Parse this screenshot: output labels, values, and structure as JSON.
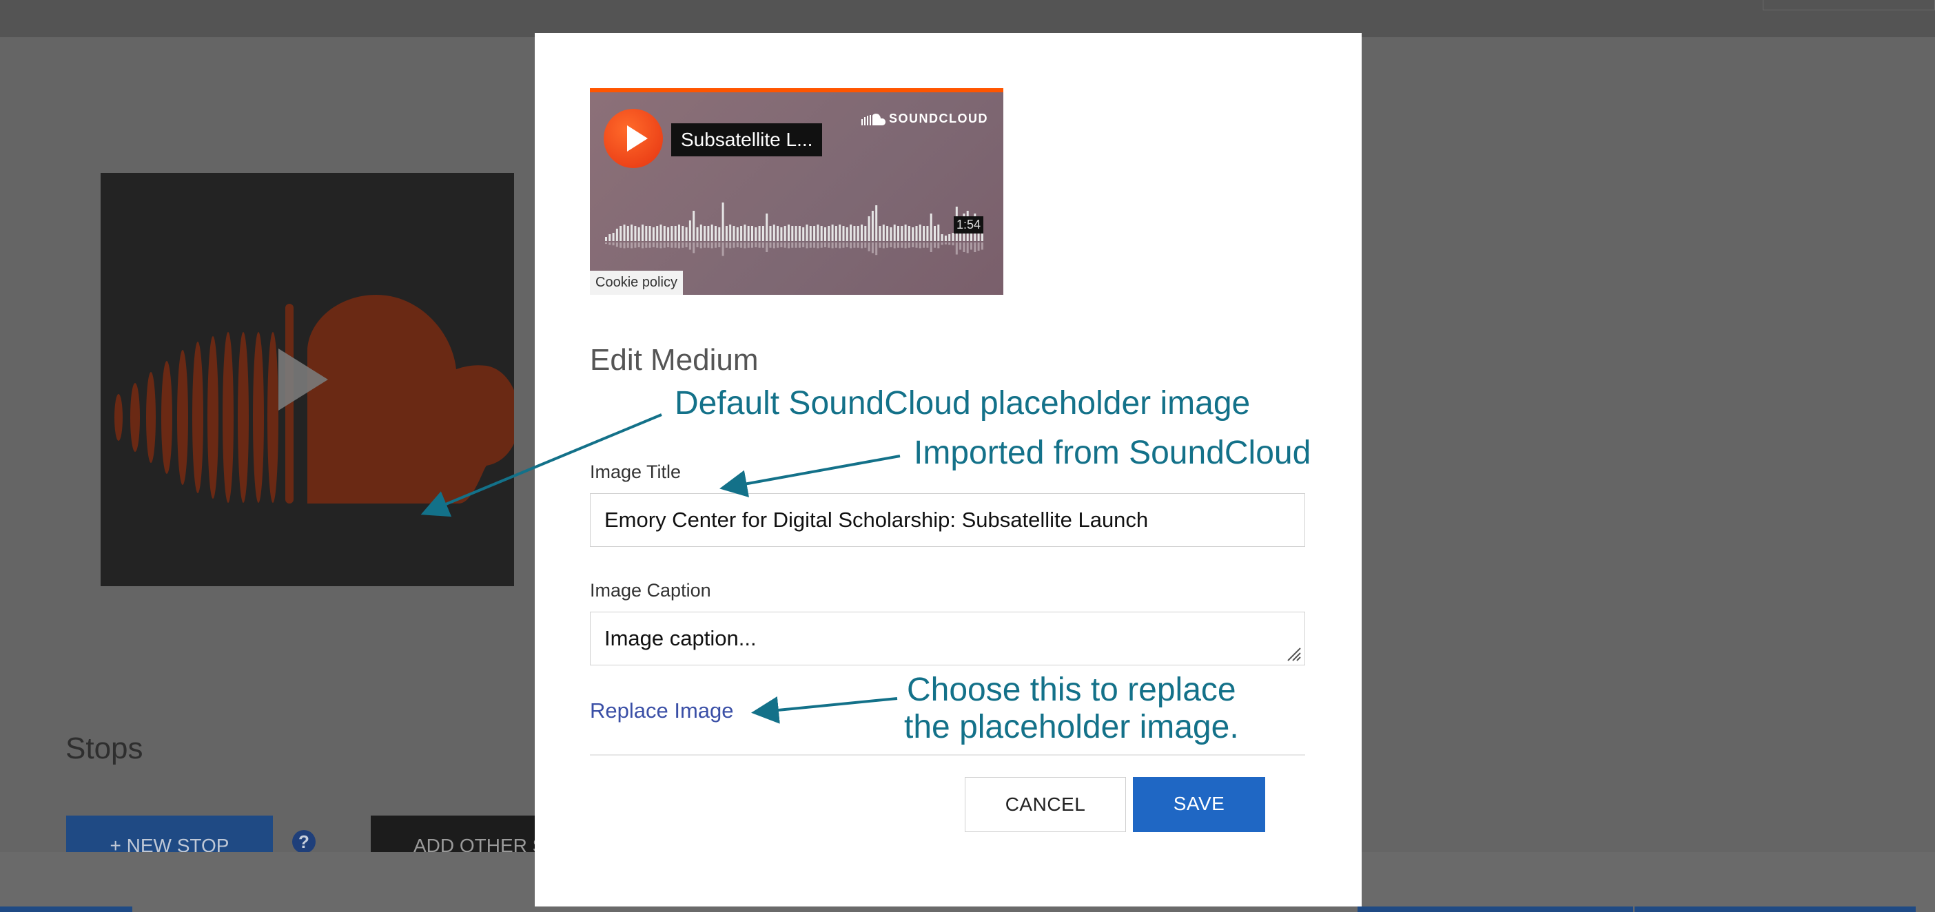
{
  "modal": {
    "embed": {
      "track_title": "Subsatellite L...",
      "brand": "SOUNDCLOUD",
      "duration": "1:54",
      "cookie_link": "Cookie policy"
    },
    "heading": "Edit Medium",
    "image_title_label": "Image Title",
    "image_title_value": "Emory Center for Digital Scholarship: Subsatellite Launch",
    "image_caption_label": "Image Caption",
    "image_caption_placeholder": "Image caption...",
    "replace_link": "Replace Image",
    "cancel_label": "CANCEL",
    "save_label": "SAVE"
  },
  "background": {
    "stops_heading": "Stops",
    "new_stop_label": "+ NEW STOP",
    "help_icon": "?",
    "add_other_label": "ADD OTHER S"
  },
  "annotations": {
    "placeholder_note": "Default SoundCloud placeholder image",
    "imported_note": "Imported from SoundCloud",
    "replace_note_line1": "Choose this to replace",
    "replace_note_line2": "the placeholder image."
  },
  "colors": {
    "annotation": "#137189",
    "save_button": "#1f67c4",
    "soundcloud_orange": "#ff5500"
  }
}
